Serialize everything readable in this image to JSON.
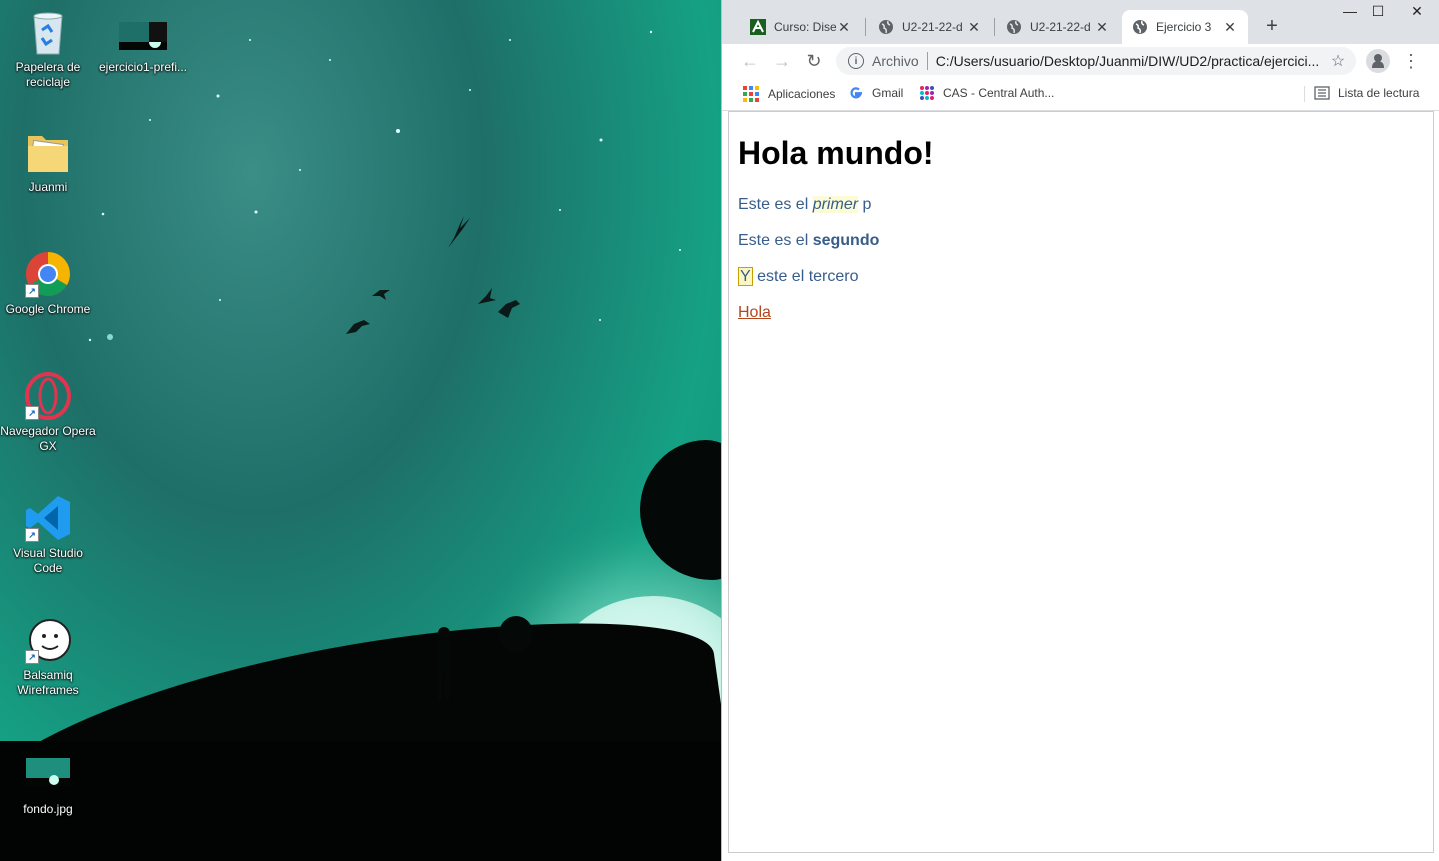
{
  "desktop": {
    "icons": [
      {
        "label": "Papelera de reciclaje",
        "icon": "recycle-bin-icon"
      },
      {
        "label": "ejercicio1-prefi...",
        "icon": "image-file-icon"
      },
      {
        "label": "Juanmi",
        "icon": "folder-icon"
      },
      {
        "label": "Google Chrome",
        "icon": "chrome-icon"
      },
      {
        "label": "Navegador Opera GX",
        "icon": "opera-gx-icon"
      },
      {
        "label": "Visual Studio Code",
        "icon": "vscode-icon"
      },
      {
        "label": "Balsamiq Wireframes",
        "icon": "balsamiq-icon"
      },
      {
        "label": "fondo.jpg",
        "icon": "image-file-icon"
      }
    ]
  },
  "browser": {
    "tabs": [
      {
        "title": "Curso: Diseño",
        "icon": "moodle-icon",
        "active": false
      },
      {
        "title": "U2-21-22-d",
        "icon": "globe-icon",
        "active": false
      },
      {
        "title": "U2-21-22-d",
        "icon": "globe-icon",
        "active": false
      },
      {
        "title": "Ejercicio 3",
        "icon": "globe-icon",
        "active": true
      }
    ],
    "new_tab_symbol": "+",
    "window_controls": {
      "minimize": "—",
      "maximize": "☐",
      "close": "✕"
    },
    "omnibox": {
      "scheme_label": "Archivo",
      "url": "C:/Users/usuario/Desktop/Juanmi/DIW/UD2/practica/ejercici..."
    },
    "bookmarks": [
      {
        "label": "Aplicaciones",
        "icon": "apps-grid-icon"
      },
      {
        "label": "Gmail",
        "icon": "google-icon"
      },
      {
        "label": "CAS - Central Auth...",
        "icon": "cas-icon"
      }
    ],
    "reading_list": "Lista de lectura"
  },
  "page": {
    "heading": "Hola mundo!",
    "p1": {
      "before": "Este es el ",
      "emph": "primer",
      "after": " p"
    },
    "p2": {
      "before": "Este es el ",
      "strong": "segundo"
    },
    "p3": {
      "boxed": "Y",
      "after": " este el tercero"
    },
    "link": "Hola"
  },
  "colors": {
    "paragraph_text": "#385d8a",
    "link_text": "#b5451b",
    "tabstrip_bg": "#dee1e6"
  }
}
